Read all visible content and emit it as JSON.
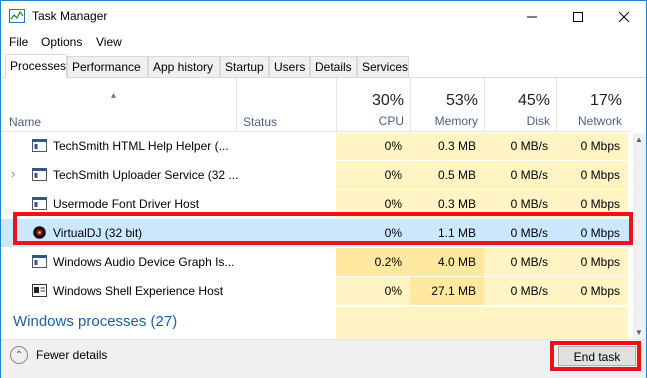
{
  "window": {
    "title": "Task Manager",
    "minimize_label": "—",
    "maximize_label": "☐",
    "close_label": "✕"
  },
  "menu": [
    "File",
    "Options",
    "View"
  ],
  "tabs": [
    "Processes",
    "Performance",
    "App history",
    "Startup",
    "Users",
    "Details",
    "Services"
  ],
  "active_tab": "Processes",
  "columns": {
    "name": "Name",
    "status": "Status",
    "cpu": {
      "pct": "30%",
      "label": "CPU"
    },
    "memory": {
      "pct": "53%",
      "label": "Memory"
    },
    "disk": {
      "pct": "45%",
      "label": "Disk"
    },
    "network": {
      "pct": "17%",
      "label": "Network"
    }
  },
  "processes": [
    {
      "name": "TechSmith HTML Help Helper (...",
      "cpu": "0%",
      "memory": "0.3 MB",
      "disk": "0 MB/s",
      "network": "0 Mbps",
      "icon": "app-window-icon",
      "expandable": false
    },
    {
      "name": "TechSmith Uploader Service (32 ...",
      "cpu": "0%",
      "memory": "0.5 MB",
      "disk": "0 MB/s",
      "network": "0 Mbps",
      "icon": "app-window-icon",
      "expandable": true
    },
    {
      "name": "Usermode Font Driver Host",
      "cpu": "0%",
      "memory": "0.3 MB",
      "disk": "0 MB/s",
      "network": "0 Mbps",
      "icon": "app-window-icon",
      "expandable": false
    },
    {
      "name": "VirtualDJ (32 bit)",
      "cpu": "0%",
      "memory": "1.1 MB",
      "disk": "0 MB/s",
      "network": "0 Mbps",
      "icon": "virtualdj-icon",
      "expandable": false,
      "selected": true
    },
    {
      "name": "Windows Audio Device Graph Is...",
      "cpu": "0.2%",
      "memory": "4.0 MB",
      "disk": "0 MB/s",
      "network": "0 Mbps",
      "icon": "app-window-icon",
      "expandable": false
    },
    {
      "name": "Windows Shell Experience Host",
      "cpu": "0%",
      "memory": "27.1 MB",
      "disk": "0 MB/s",
      "network": "0 Mbps",
      "icon": "shell-host-icon",
      "expandable": false
    }
  ],
  "group_header": "Windows processes (27)",
  "footer": {
    "fewer_details": "Fewer details",
    "end_task": "End task"
  },
  "colors": {
    "highlight_red": "#e8141c",
    "selected_row": "#cce8ff",
    "heat_light": "#fff4c4",
    "heat_medium": "#ffe8a0",
    "accent_blue": "#1e5fa6"
  }
}
